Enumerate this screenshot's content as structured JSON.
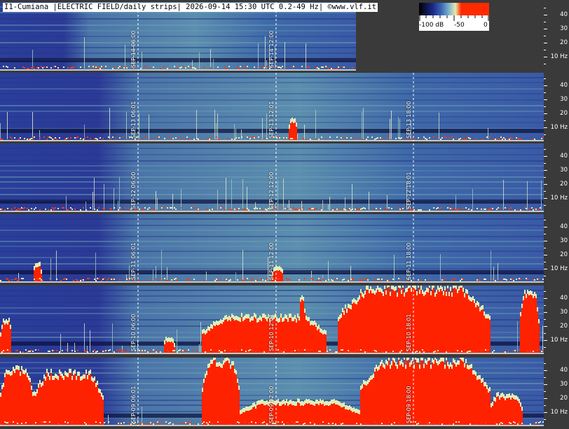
{
  "header": {
    "title": "I1-Cumiana |ELECTRIC FIELD/daily strips| 2026-09-14 15:30 UTC 0.2-49 Hz| ©www.vlf.it"
  },
  "colorbar": {
    "labels": [
      "-100 dB",
      "-50",
      "0"
    ]
  },
  "freq_axis": {
    "ticks": [
      "40",
      "30",
      "20",
      "10 Hz"
    ]
  },
  "colors": {
    "background": "#3a3a3a",
    "spectrogram_low": "#1c2a8c",
    "spectrogram_mid": "#5f8fb8",
    "spectrogram_high": "#d9e8b0",
    "saturation": "#ff2200",
    "separator": "#c8c8c8"
  },
  "strips": [
    {
      "day": "SEP-14",
      "marks": [
        "06:00",
        "12:00"
      ]
    },
    {
      "day": "SEP-13",
      "marks": [
        "06:01",
        "12:01",
        "18:00"
      ]
    },
    {
      "day": "SEP-12",
      "marks": [
        "06:00",
        "12:00",
        "18:01"
      ]
    },
    {
      "day": "SEP-11",
      "marks": [
        "06:01",
        "12:00",
        "18:00"
      ]
    },
    {
      "day": "SEP-10",
      "marks": [
        "06:00",
        "12:01",
        "18:01"
      ]
    },
    {
      "day": "SEP-09",
      "marks": [
        "06:01",
        "12:00",
        "18:00"
      ]
    }
  ]
}
